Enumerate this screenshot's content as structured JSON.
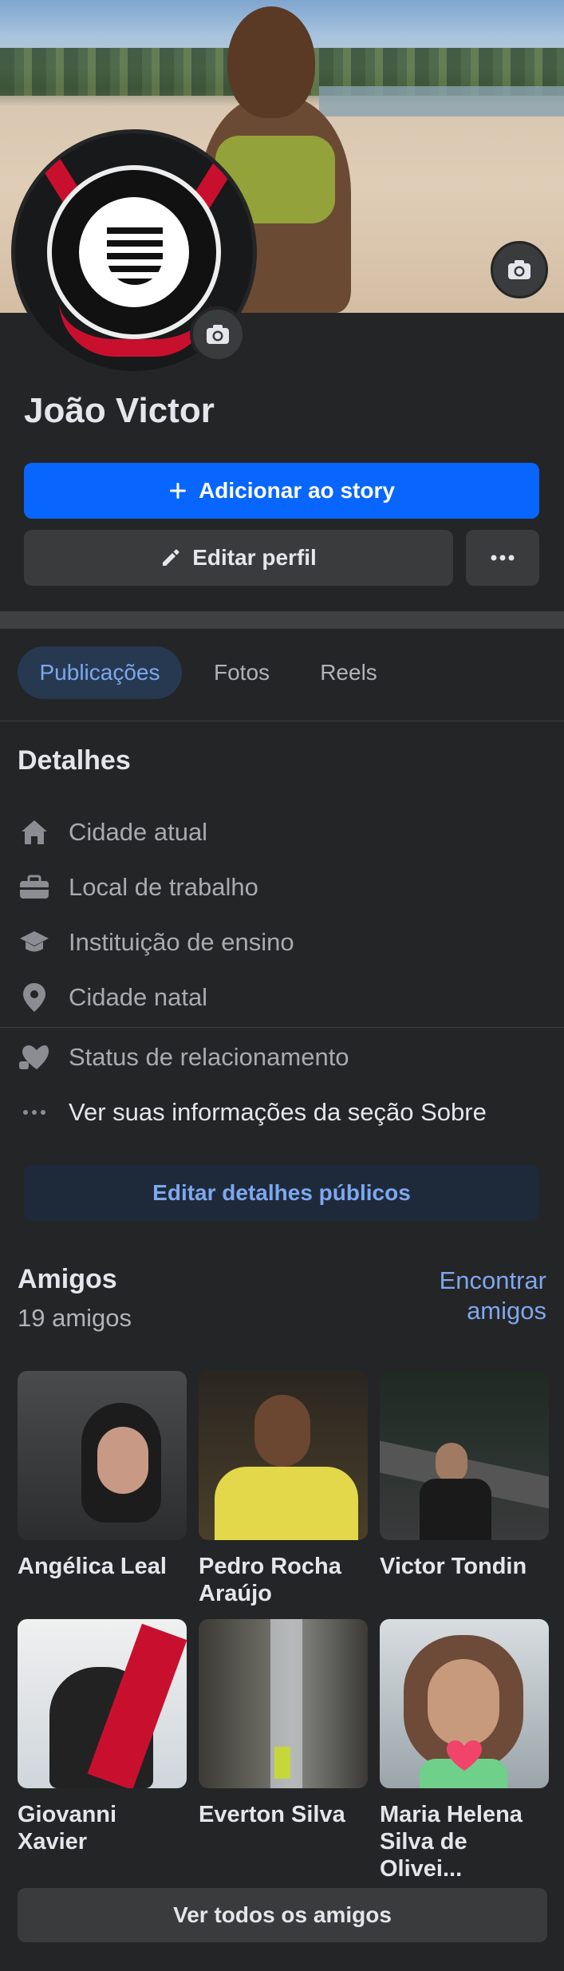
{
  "profile": {
    "name": "João Victor"
  },
  "actions": {
    "add_story": "Adicionar ao story",
    "edit_profile": "Editar perfil"
  },
  "tabs": [
    {
      "label": "Publicações",
      "active": true
    },
    {
      "label": "Fotos",
      "active": false
    },
    {
      "label": "Reels",
      "active": false
    }
  ],
  "details": {
    "title": "Detalhes",
    "items": [
      {
        "label": "Cidade atual",
        "icon": "home-icon"
      },
      {
        "label": "Local de trabalho",
        "icon": "briefcase-icon"
      },
      {
        "label": "Instituição de ensino",
        "icon": "graduation-cap-icon"
      },
      {
        "label": "Cidade natal",
        "icon": "location-pin-icon"
      },
      {
        "label": "Status de relacionamento",
        "icon": "heart-icon"
      },
      {
        "label": "Ver suas informações da seção Sobre",
        "icon": "more-dots-icon"
      }
    ],
    "edit_button": "Editar detalhes públicos"
  },
  "friends": {
    "title": "Amigos",
    "count": "19 amigos",
    "find_line1": "Encontrar",
    "find_line2": "amigos",
    "list": [
      {
        "name": "Angélica Leal"
      },
      {
        "name": "Pedro Rocha Araújo"
      },
      {
        "name": "Victor Tondin"
      },
      {
        "name": "Giovanni Xavier"
      },
      {
        "name": "Everton Silva"
      },
      {
        "name": "Maria Helena Silva de Olivei..."
      }
    ],
    "see_all": "Ver todos os amigos"
  },
  "colors": {
    "background": "#242526",
    "primary_button": "#0866ff",
    "active_tab_text": "#7ea7ee",
    "secondary_button": "#3a3b3c"
  }
}
